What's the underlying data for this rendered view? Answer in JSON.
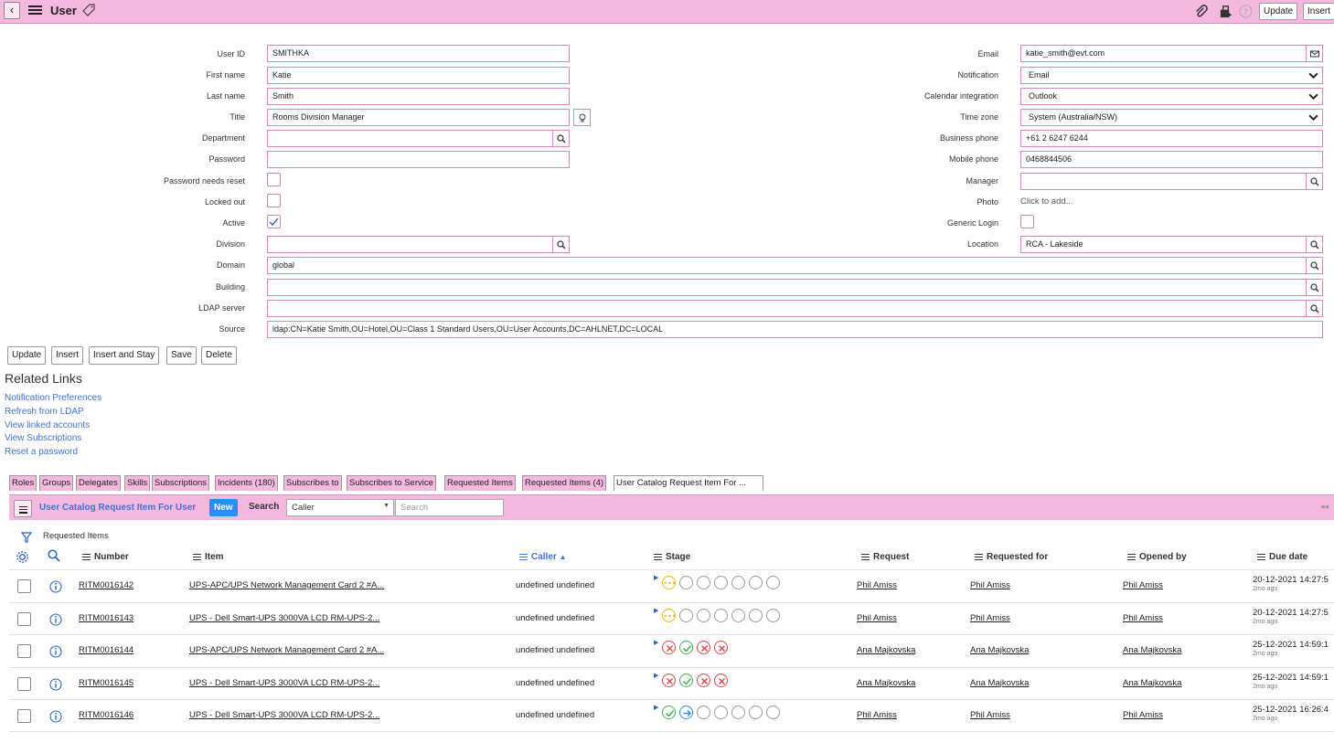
{
  "header": {
    "title": "User",
    "update_label": "Update",
    "insert_label": "Insert"
  },
  "form": {
    "user_id": {
      "label": "User ID",
      "value": "SMITHKA"
    },
    "first_name": {
      "label": "First name",
      "value": "Katie"
    },
    "last_name": {
      "label": "Last name",
      "value": "Smith"
    },
    "title": {
      "label": "Title",
      "value": "Rooms Division Manager"
    },
    "department": {
      "label": "Department",
      "value": ""
    },
    "password": {
      "label": "Password",
      "value": ""
    },
    "password_reset": {
      "label": "Password needs reset"
    },
    "locked_out": {
      "label": "Locked out"
    },
    "active": {
      "label": "Active"
    },
    "division": {
      "label": "Division",
      "value": ""
    },
    "domain": {
      "label": "Domain",
      "value": "global"
    },
    "building": {
      "label": "Building",
      "value": ""
    },
    "ldap_server": {
      "label": "LDAP server",
      "value": ""
    },
    "source": {
      "label": "Source",
      "value": "ldap:CN=Katie Smith,OU=Hotel,OU=Class 1 Standard Users,OU=User Accounts,DC=AHLNET,DC=LOCAL"
    },
    "email": {
      "label": "Email",
      "value": "katie_smith@evt.com"
    },
    "notification": {
      "label": "Notification",
      "value": "Email"
    },
    "calendar": {
      "label": "Calendar integration",
      "value": "Outlook"
    },
    "timezone": {
      "label": "Time zone",
      "value": "System (Australia/NSW)"
    },
    "business_phone": {
      "label": "Business phone",
      "value": "+61 2 6247 6244"
    },
    "mobile_phone": {
      "label": "Mobile phone",
      "value": "0468844506"
    },
    "manager": {
      "label": "Manager",
      "value": ""
    },
    "photo": {
      "label": "Photo",
      "value": "Click to add..."
    },
    "generic_login": {
      "label": "Generic Login"
    },
    "location": {
      "label": "Location",
      "value": "RCA - Lakeside"
    }
  },
  "form_buttons": {
    "update": "Update",
    "insert": "Insert",
    "insert_stay": "Insert and Stay",
    "save": "Save",
    "delete": "Delete"
  },
  "related_links": {
    "title": "Related Links",
    "items": [
      "Notification Preferences",
      "Refresh from LDAP",
      "View linked accounts",
      "View Subscriptions",
      "Reset a password"
    ]
  },
  "tabs": [
    "Roles",
    "Groups",
    "Delegates",
    "Skills",
    "Subscriptions",
    "Incidents (180)",
    "Subscribes to",
    "Subscribes to Service",
    "Requested Items",
    "Requested Items (4)",
    "User Catalog Request Item For ..."
  ],
  "list": {
    "title": "User Catalog Request Item For User",
    "new_label": "New",
    "search_label": "Search",
    "search_field": "Caller",
    "search_placeholder": "Search",
    "breadcrumb": "Requested Items",
    "columns": {
      "number": "Number",
      "item": "Item",
      "caller": "Caller",
      "stage": "Stage",
      "request": "Request",
      "requested_for": "Requested for",
      "opened_by": "Opened by",
      "due_date": "Due date"
    },
    "rows": [
      {
        "number": "RITM0016142",
        "item": "UPS-APC/UPS Network Management Card 2 #A...",
        "caller": "undefined undefined",
        "stages": [
          "pending",
          "empty",
          "empty",
          "empty",
          "empty",
          "empty",
          "empty"
        ],
        "request": "Phil Amiss",
        "requested_for": "Phil Amiss",
        "opened_by": "Phil Amiss",
        "due": "20-12-2021 14:27:5",
        "due_ago": "2mo ago"
      },
      {
        "number": "RITM0016143",
        "item": "UPS - Dell Smart-UPS 3000VA LCD RM-UPS-2...",
        "caller": "undefined undefined",
        "stages": [
          "pending",
          "empty",
          "empty",
          "empty",
          "empty",
          "empty",
          "empty"
        ],
        "request": "Phil Amiss",
        "requested_for": "Phil Amiss",
        "opened_by": "Phil Amiss",
        "due": "20-12-2021 14:27:5",
        "due_ago": "2mo ago"
      },
      {
        "number": "RITM0016144",
        "item": "UPS-APC/UPS Network Management Card 2 #A...",
        "caller": "undefined undefined",
        "stages": [
          "cancel",
          "done",
          "cancel",
          "cancel"
        ],
        "request": "Ana Majkovska",
        "requested_for": "Ana Majkovska",
        "opened_by": "Ana Majkovska",
        "due": "25-12-2021 14:59:1",
        "due_ago": "2mo ago"
      },
      {
        "number": "RITM0016145",
        "item": "UPS - Dell Smart-UPS 3000VA LCD RM-UPS-2...",
        "caller": "undefined undefined",
        "stages": [
          "cancel",
          "done",
          "cancel",
          "cancel"
        ],
        "request": "Ana Majkovska",
        "requested_for": "Ana Majkovska",
        "opened_by": "Ana Majkovska",
        "due": "25-12-2021 14:59:1",
        "due_ago": "2mo ago"
      },
      {
        "number": "RITM0016146",
        "item": "UPS - Dell Smart-UPS 3000VA LCD RM-UPS-2...",
        "caller": "undefined undefined",
        "stages": [
          "done",
          "progress",
          "empty",
          "empty",
          "empty",
          "empty",
          "empty"
        ],
        "request": "Phil Amiss",
        "requested_for": "Phil Amiss",
        "opened_by": "Phil Amiss",
        "due": "25-12-2021 16:26:4",
        "due_ago": "2mo ago"
      }
    ]
  },
  "colors": {
    "header_bg": "#f5b8df",
    "field_border": "#d38ab8",
    "link": "#3f74d0",
    "new_button": "#278efc"
  }
}
